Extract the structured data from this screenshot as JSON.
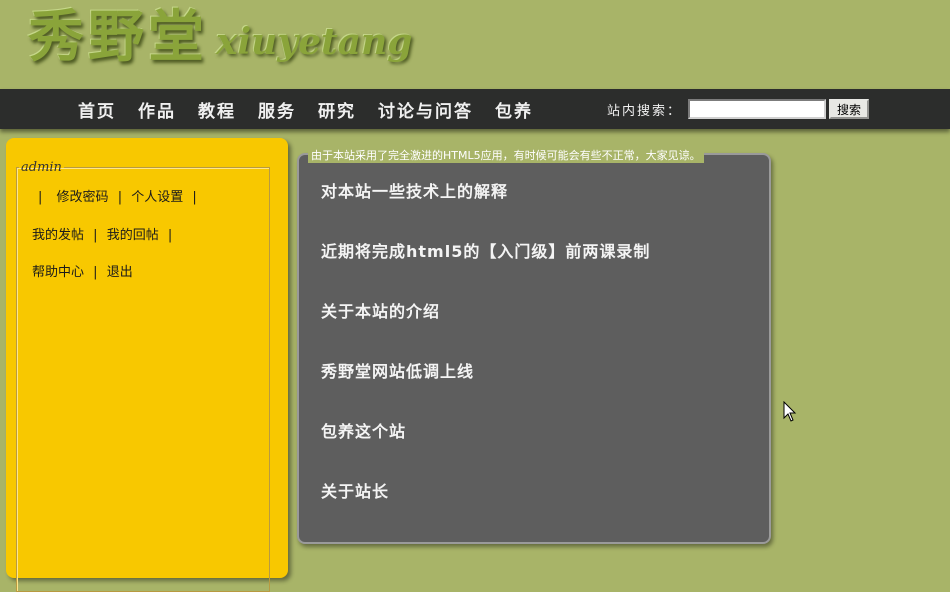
{
  "header": {
    "logo_cn": "秀野堂",
    "logo_en": "xiuyetang"
  },
  "nav": {
    "items": [
      {
        "label": "首页"
      },
      {
        "label": "作品"
      },
      {
        "label": "教程"
      },
      {
        "label": "服务"
      },
      {
        "label": "研究"
      },
      {
        "label": "讨论与问答"
      },
      {
        "label": "包养"
      }
    ],
    "search_label": "站内搜索：",
    "search_value": "",
    "search_button": "搜索"
  },
  "sidebar": {
    "legend": "admin",
    "links": {
      "change_password": "修改密码",
      "personal_settings": "个人设置",
      "my_posts": "我的发帖",
      "my_replies": "我的回帖",
      "help_center": "帮助中心",
      "logout": "退出"
    },
    "separator": "|"
  },
  "main": {
    "notice": "由于本站采用了完全激进的HTML5应用，有时候可能会有些不正常，大家见谅。",
    "articles": [
      {
        "title": "对本站一些技术上的解释"
      },
      {
        "title": "近期将完成html5的【入门级】前两课录制"
      },
      {
        "title": "关于本站的介绍"
      },
      {
        "title": "秀野堂网站低调上线"
      },
      {
        "title": "包养这个站"
      },
      {
        "title": "关于站长"
      }
    ]
  },
  "icons": {
    "cursor": "mouse-pointer-icon"
  }
}
